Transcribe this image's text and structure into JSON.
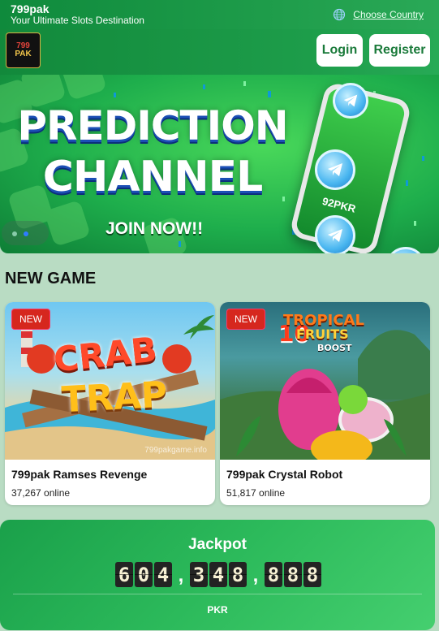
{
  "topbar": {
    "brand": "799pak",
    "tagline": "Your Ultimate Slots Destination",
    "country_label": "Choose Country",
    "globe_icon": "globe-icon"
  },
  "header": {
    "logo_lines": [
      "799",
      "PAK"
    ],
    "login_label": "Login",
    "register_label": "Register"
  },
  "banner": {
    "line1": "PREDICTION",
    "line2": "CHANNEL",
    "cta": "JOIN NOW!!",
    "phone_brand": "92PKR",
    "icons": [
      "telegram-icon"
    ]
  },
  "section": {
    "title": "NEW GAME"
  },
  "games": [
    {
      "badge": "NEW",
      "art_text": [
        "CRAB",
        "TRAP"
      ],
      "watermark": "799pakgame.info",
      "name": "799pak Ramses Revenge",
      "online": "37,267 online"
    },
    {
      "badge": "NEW",
      "art_text": [
        "10",
        "TROPICAL",
        "FRUITS",
        "BOOST"
      ],
      "name": "799pak Crystal Robot",
      "online": "51,817 online"
    }
  ],
  "jackpot": {
    "title": "Jackpot",
    "digits_group1": [
      "6",
      "0",
      "4"
    ],
    "digits_group2": [
      "3",
      "4",
      "8"
    ],
    "digits_group3": [
      "8",
      "8",
      "8"
    ],
    "separator": ",",
    "currency": "PKR"
  },
  "colors": {
    "brand_green": "#1e9c4a",
    "badge_red": "#d6271e",
    "page_bg": "#b9dcc3"
  }
}
